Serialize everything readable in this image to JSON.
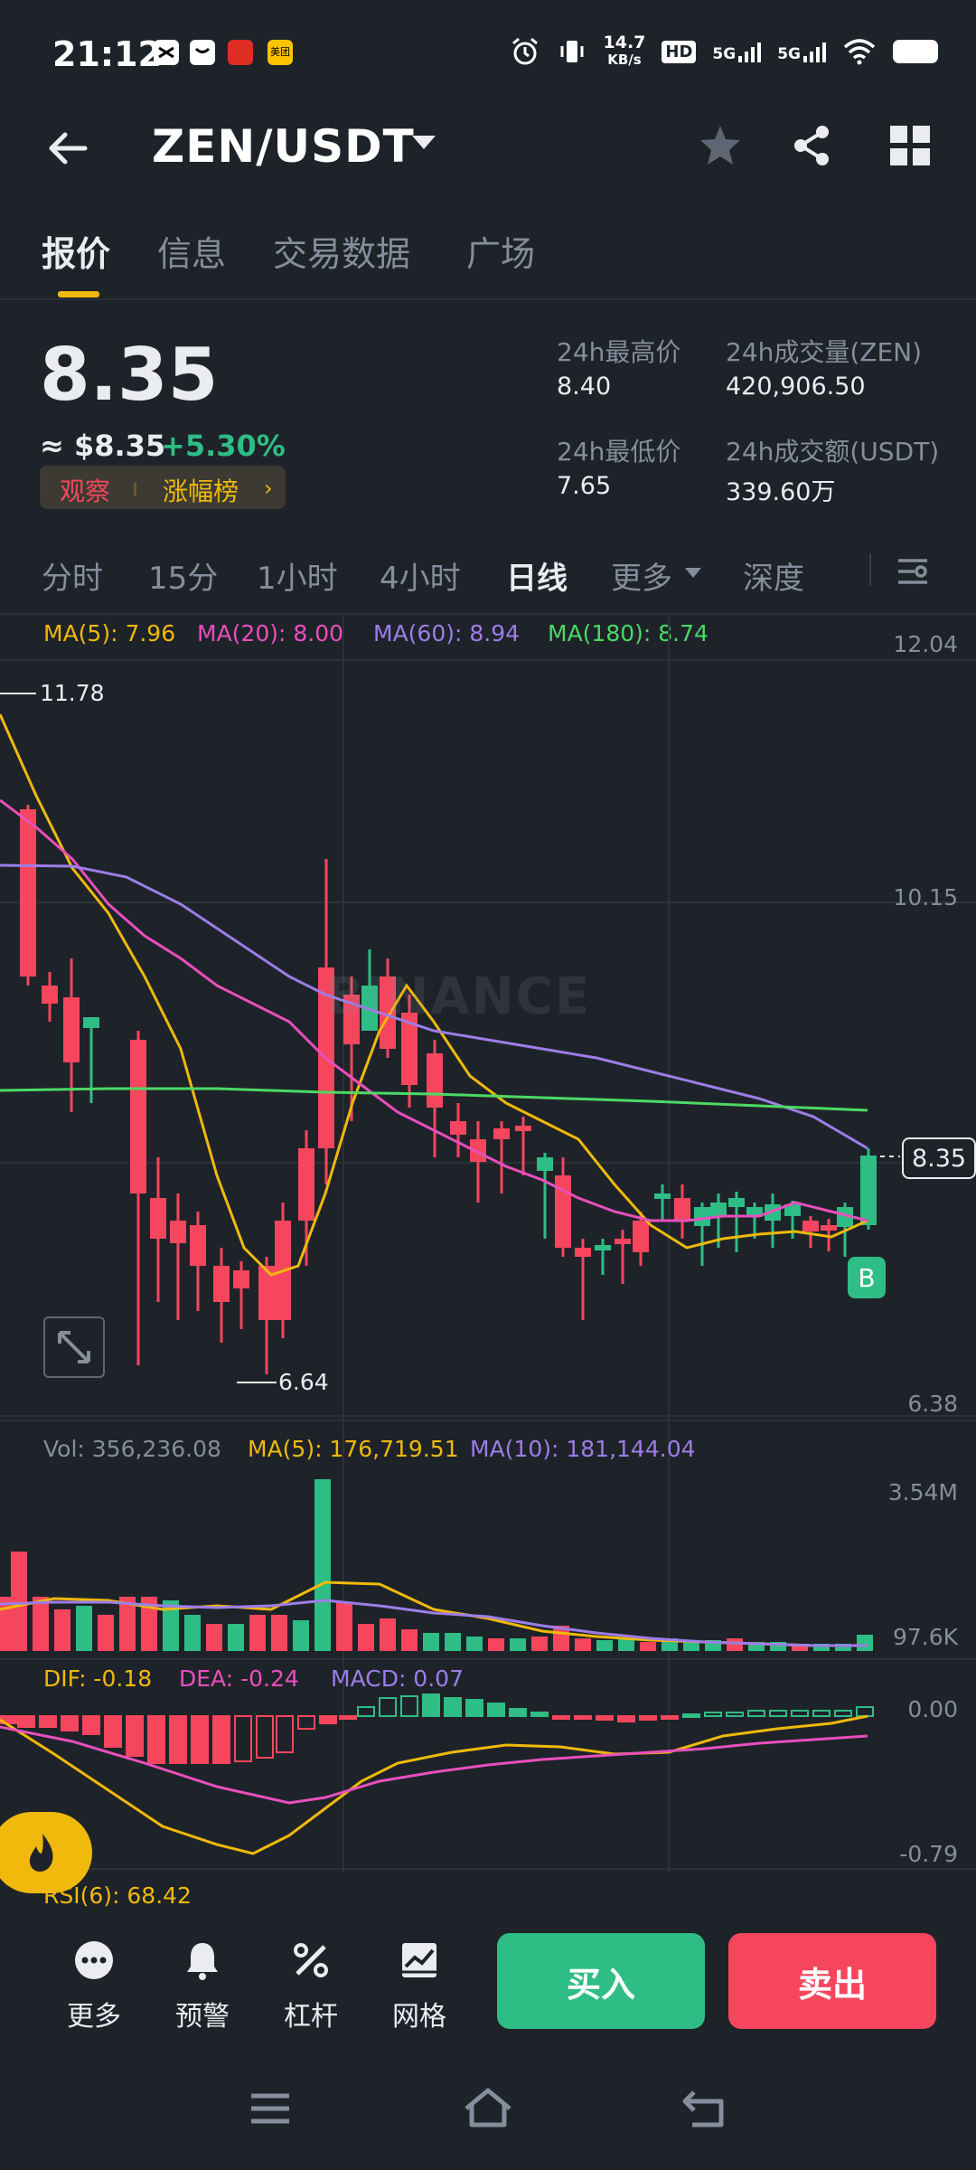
{
  "status_bar": {
    "time": "21:12",
    "net_speed_top": "14.7",
    "net_speed_unit": "KB/s",
    "hd_label": "HD",
    "signal1": "5G",
    "signal2": "5G",
    "app_icon_meituan": "美团"
  },
  "header": {
    "pair": "ZEN/USDT"
  },
  "tabs": [
    "报价",
    "信息",
    "交易数据",
    "广场"
  ],
  "ticker": {
    "price": "8.35",
    "usd_price": "≈ $8.35",
    "change_pct": "+5.30%",
    "badge_watch": "观察",
    "badge_gainers": "涨幅榜",
    "high_label": "24h最高价",
    "high_value": "8.40",
    "vol_label": "24h成交量(ZEN)",
    "vol_value": "420,906.50",
    "low_label": "24h最低价",
    "low_value": "7.65",
    "turnover_label": "24h成交额(USDT)",
    "turnover_value": "339.60万"
  },
  "intervals": [
    "分时",
    "15分",
    "1小时",
    "4小时",
    "日线",
    "更多",
    "深度"
  ],
  "chart": {
    "ma_labels": [
      "MA(5): 7.96",
      "MA(20): 8.00",
      "MA(60): 8.94",
      "MA(180): 8.74"
    ],
    "y_labels": [
      "12.04",
      "10.15",
      "6.38"
    ],
    "high_marker": "11.78",
    "low_marker": "6.64",
    "last_price_tag": "8.35",
    "buy_marker": "B",
    "watermark": "BINANCE",
    "volume_legend": [
      "Vol: 356,236.08",
      "MA(5): 176,719.51",
      "MA(10): 181,144.04"
    ],
    "volume_axis": [
      "3.54M",
      "97.6K"
    ],
    "macd_legend": [
      "DIF: -0.18",
      "DEA: -0.24",
      "MACD: 0.07"
    ],
    "macd_axis": [
      "0.00",
      "-0.79"
    ],
    "rsi_legend": "RSI(6): 68.42",
    "colors": {
      "up": "#2ebd85",
      "down": "#f6465d",
      "ma5": "#f0b90b",
      "ma20": "#e94fbd",
      "ma60": "#9d7de8",
      "ma180": "#4cd964"
    }
  },
  "bottom_actions": [
    "更多",
    "预警",
    "杠杆",
    "网格"
  ],
  "buy_label": "买入",
  "sell_label": "卖出"
}
